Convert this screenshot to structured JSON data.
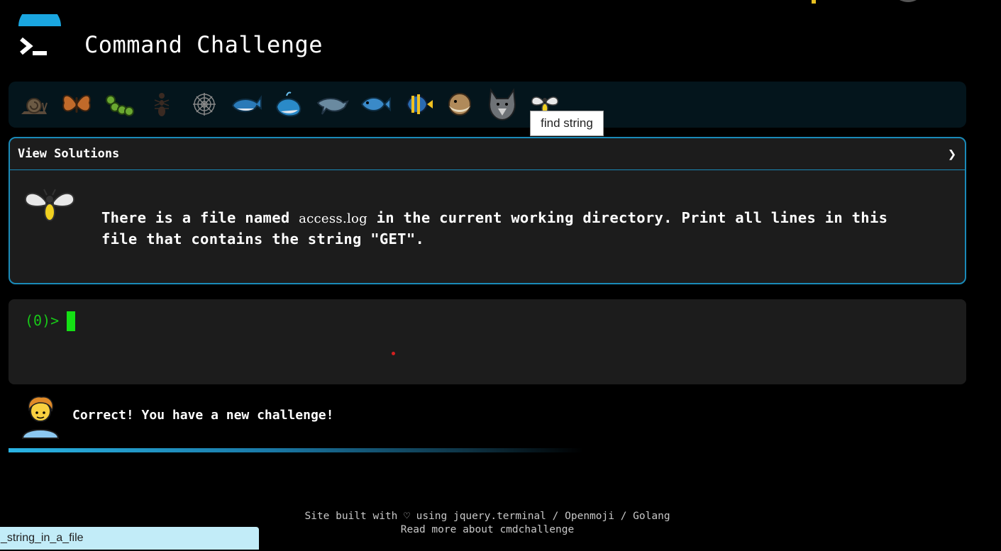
{
  "header": {
    "title": "Command Challenge",
    "logo_icon": "terminal-prompt-icon"
  },
  "challenges": [
    {
      "icon": "snail-icon"
    },
    {
      "icon": "butterfly-icon"
    },
    {
      "icon": "caterpillar-icon"
    },
    {
      "icon": "ant-icon"
    },
    {
      "icon": "spider-web-icon"
    },
    {
      "icon": "whale-icon"
    },
    {
      "icon": "spouting-whale-icon"
    },
    {
      "icon": "dolphin-icon"
    },
    {
      "icon": "fish-icon"
    },
    {
      "icon": "tropical-fish-icon"
    },
    {
      "icon": "blowfish-icon"
    },
    {
      "icon": "wolf-icon"
    },
    {
      "icon": "firefly-icon"
    }
  ],
  "tooltip": {
    "text": "find string"
  },
  "solutions": {
    "title": "View Solutions",
    "chevron": "❯",
    "task_icon": "firefly-icon",
    "task_before": "There is a file named ",
    "task_code": "access.log",
    "task_after": " in the current working directory. Print all lines in this file that contains the string \"GET\"."
  },
  "terminal": {
    "prompt": "(0)>"
  },
  "feedback": {
    "avatar_icon": "person-curly-hair-icon",
    "message": "Correct! You have a new challenge!"
  },
  "footer": {
    "prefix": "Site built with ",
    "heart": "♡",
    "using": " using ",
    "link_jquery": "jquery.terminal",
    "sep1": " / ",
    "link_openmoji": "Openmoji",
    "sep2": " / ",
    "link_golang": "Golang",
    "read_more": "Read more about cmdchallenge"
  },
  "status_bar": {
    "url": "_string_in_a_file"
  },
  "colors": {
    "accent": "#1a8ab8",
    "prompt_green": "#18c818",
    "background": "#000000",
    "panel": "#1c1c1c"
  }
}
